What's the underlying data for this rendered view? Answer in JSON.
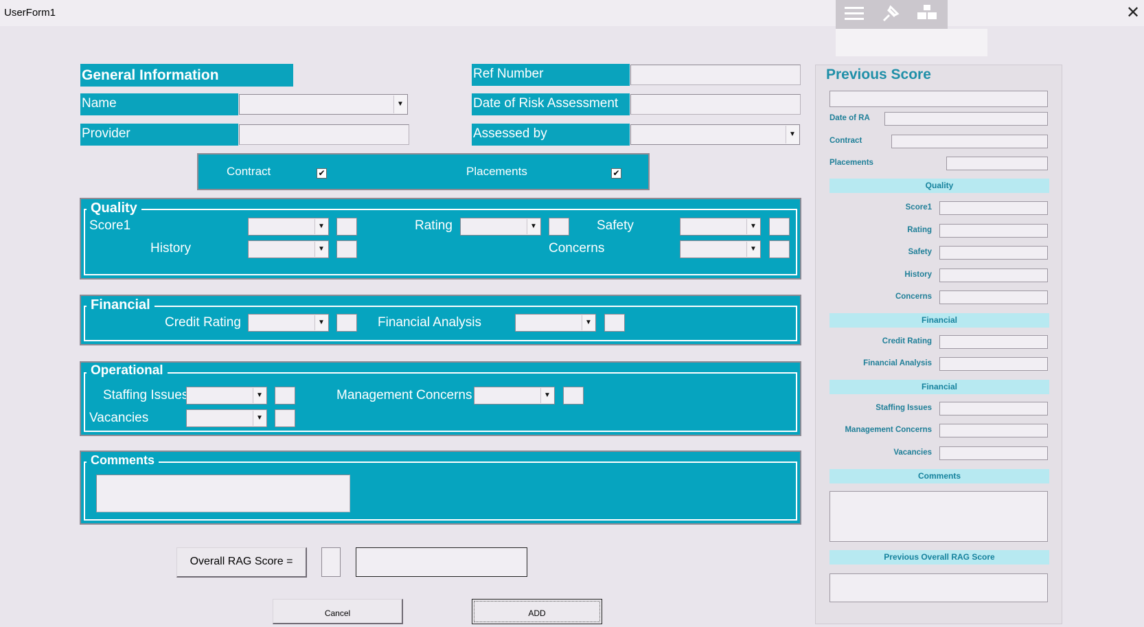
{
  "window": {
    "title": "UserForm1",
    "close_glyph": "✕"
  },
  "toolbar": {
    "icons": [
      "menu-icon",
      "unpin-icon",
      "windows-icon"
    ]
  },
  "general": {
    "header": "General Information",
    "name_label": "Name",
    "provider_label": "Provider",
    "ref_label": "Ref Number",
    "date_label": "Date of Risk Assessment",
    "assessed_label": "Assessed by"
  },
  "checks": {
    "contract_label": "Contract",
    "placements_label": "Placements",
    "contract_checked": true,
    "placements_checked": true,
    "check_glyph": "✔"
  },
  "quality": {
    "title": "Quality",
    "score1_label": "Score1",
    "history_label": "History",
    "rating_label": "Rating",
    "safety_label": "Safety",
    "concerns_label": "Concerns"
  },
  "financial": {
    "title": "Financial",
    "credit_label": "Credit Rating",
    "analysis_label": "Financial Analysis"
  },
  "operational": {
    "title": "Operational",
    "staffing_label": "Staffing Issues",
    "management_label": "Management Concerns",
    "vacancies_label": "Vacancies"
  },
  "comments": {
    "title": "Comments"
  },
  "rag": {
    "label": "Overall RAG Score ="
  },
  "buttons": {
    "cancel": "Cancel",
    "add": "ADD"
  },
  "previous": {
    "title": "Previous Score",
    "date_label": "Date of RA",
    "contract_label": "Contract",
    "placements_label": "Placements",
    "band_quality": "Quality",
    "score1_label": "Score1",
    "rating_label": "Rating",
    "safety_label": "Safety",
    "history_label": "History",
    "concerns_label": "Concerns",
    "band_financial": "Financial",
    "credit_label": "Credit Rating",
    "analysis_label": "Financial Analysis",
    "band_financial2": "Financial",
    "staffing_label": "Staffing Issues",
    "management_label": "Management Concerns",
    "vacancies_label": "Vacancies",
    "band_comments": "Comments",
    "band_rag": "Previous Overall RAG Score"
  }
}
